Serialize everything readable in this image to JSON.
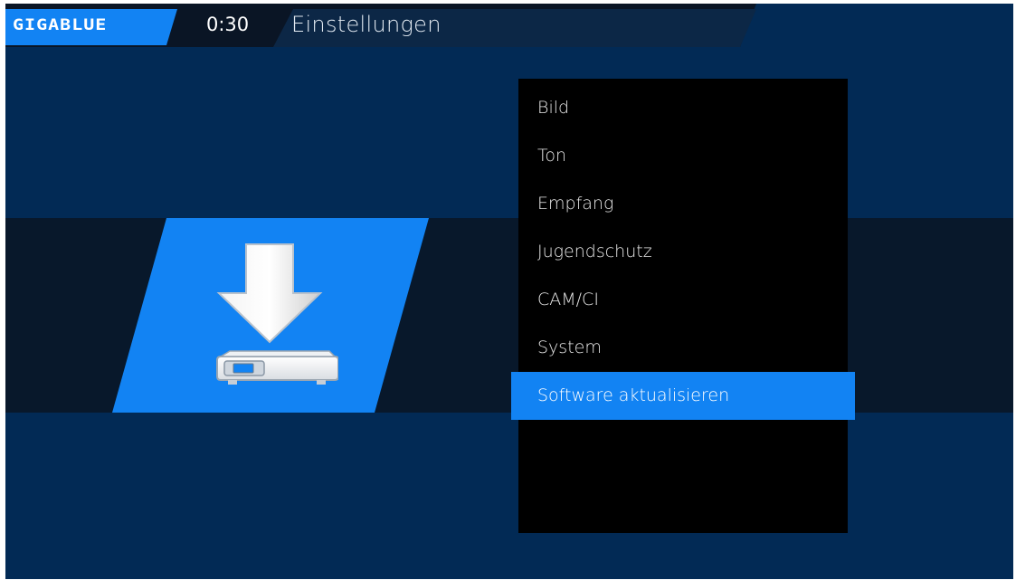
{
  "header": {
    "logo_text": "GIGABLUE",
    "clock": "0:30",
    "title": "Einstellungen"
  },
  "tile": {
    "icon": "software-update-icon"
  },
  "menu": {
    "items": [
      {
        "label": "Bild"
      },
      {
        "label": "Ton"
      },
      {
        "label": "Empfang"
      },
      {
        "label": "Jugendschutz"
      },
      {
        "label": "CAM/CI"
      },
      {
        "label": "System"
      },
      {
        "label": "Software aktualisieren",
        "selected": true
      }
    ]
  },
  "colors": {
    "background": "#022a55",
    "accent": "#1283f3",
    "band": "#08182b",
    "menu_bg": "#000000"
  }
}
